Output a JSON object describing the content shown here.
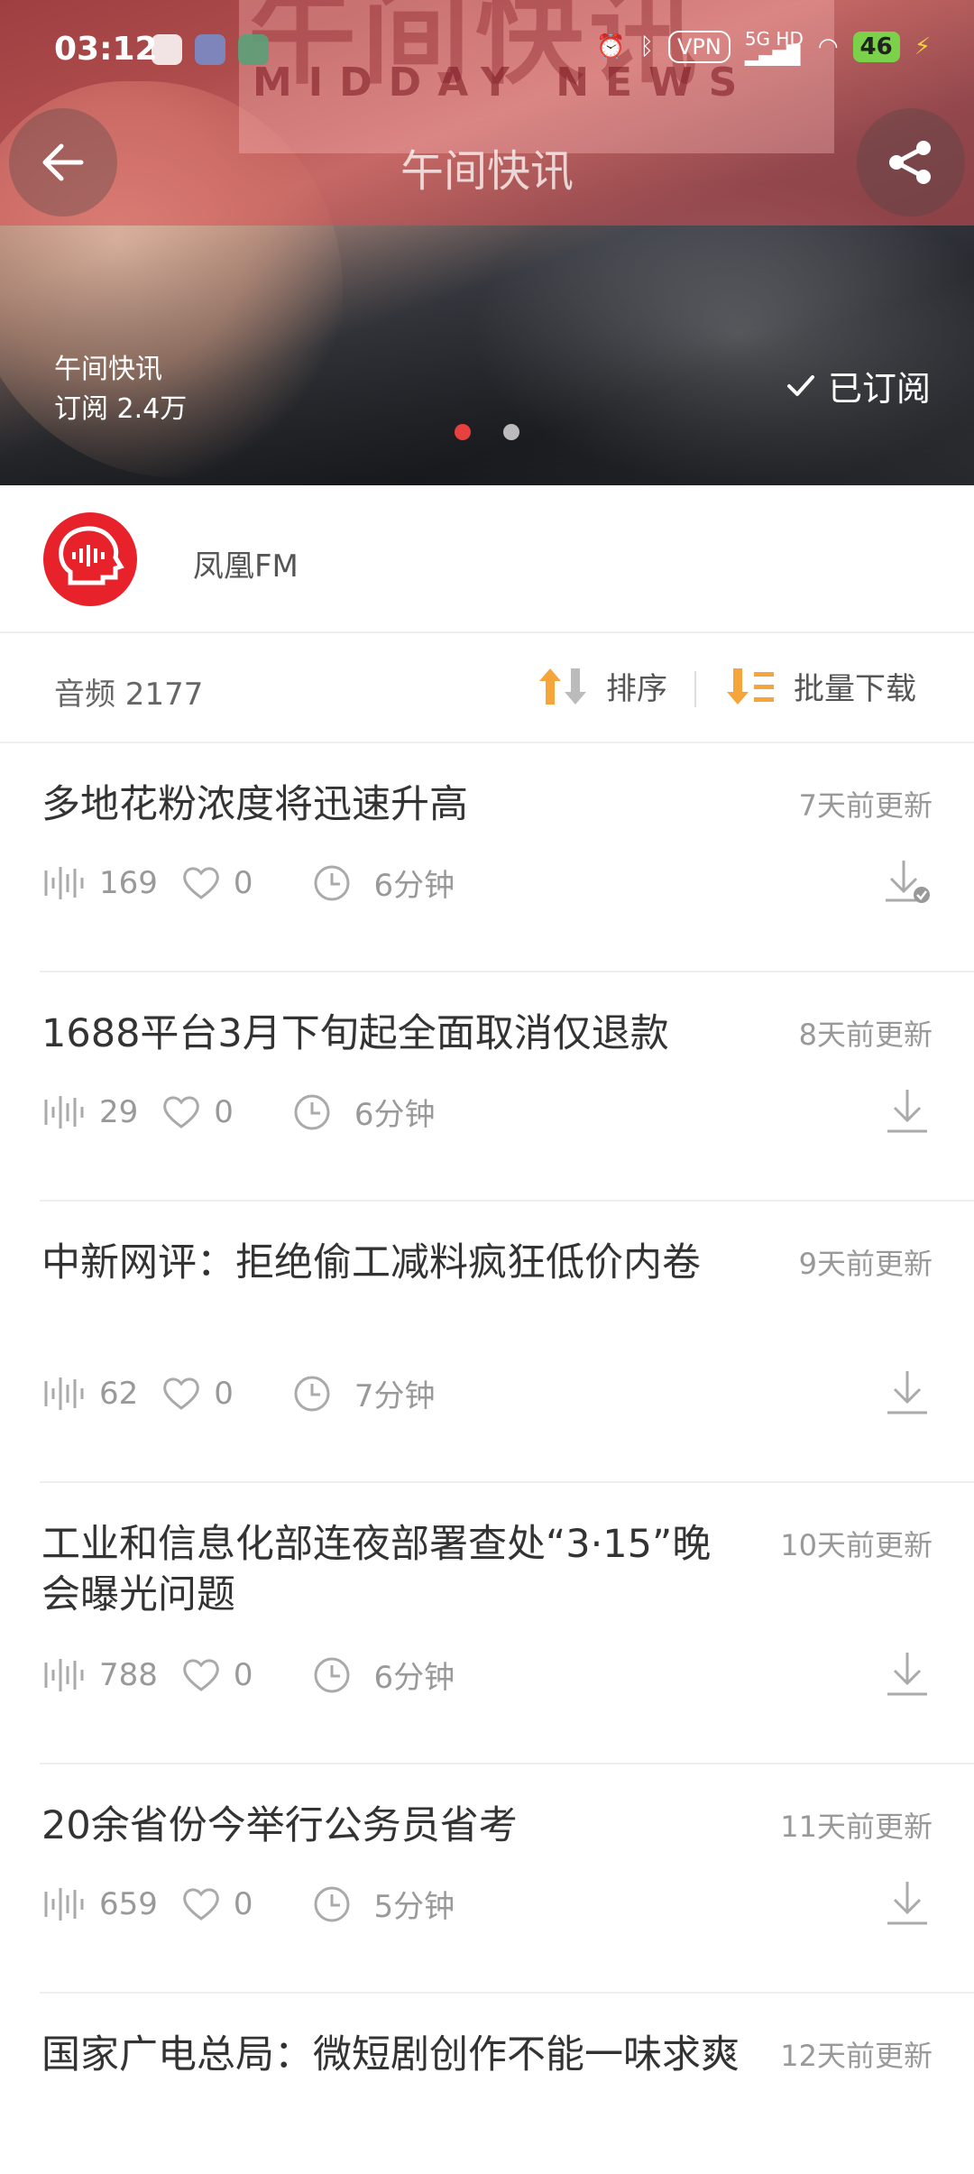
{
  "status_bar": {
    "time": "03:12",
    "vpn": "VPN",
    "network": "5G HD",
    "battery": "46"
  },
  "header": {
    "title": "午间快讯",
    "banner_watermark": "午间快讯",
    "banner_english": "MIDDAY NEWS"
  },
  "hero": {
    "program_name": "午间快讯",
    "subscribers": "订阅 2.4万",
    "subscribed_label": "已订阅",
    "carousel_pages": 2,
    "carousel_active": 1
  },
  "publisher": {
    "name": "凤凰FM"
  },
  "toolbar": {
    "count": "音频 2177",
    "sort_label": "排序",
    "batch_label": "批量下载"
  },
  "colors": {
    "accent": "#e8403e",
    "orange": "#f5a53a",
    "logo_red": "#e8222b"
  },
  "episodes": [
    {
      "title": "多地花粉浓度将迅速升高",
      "updated": "7天前更新",
      "plays": "169",
      "likes": "0",
      "duration": "6分钟",
      "downloaded": true
    },
    {
      "title": "1688平台3月下旬起全面取消仅退款",
      "updated": "8天前更新",
      "plays": "29",
      "likes": "0",
      "duration": "6分钟",
      "downloaded": false
    },
    {
      "title": "中新网评：拒绝偷工减料疯狂低价内卷",
      "updated": "9天前更新",
      "plays": "62",
      "likes": "0",
      "duration": "7分钟",
      "downloaded": false
    },
    {
      "title": "工业和信息化部连夜部署查处“3·15”晚会曝光问题",
      "updated": "10天前更新",
      "plays": "788",
      "likes": "0",
      "duration": "6分钟",
      "downloaded": false
    },
    {
      "title": "20余省份今举行公务员省考",
      "updated": "11天前更新",
      "plays": "659",
      "likes": "0",
      "duration": "5分钟",
      "downloaded": false
    },
    {
      "title": "国家广电总局：微短剧创作不能一味求爽",
      "updated": "12天前更新",
      "plays": "",
      "likes": "",
      "duration": "",
      "downloaded": false
    }
  ]
}
